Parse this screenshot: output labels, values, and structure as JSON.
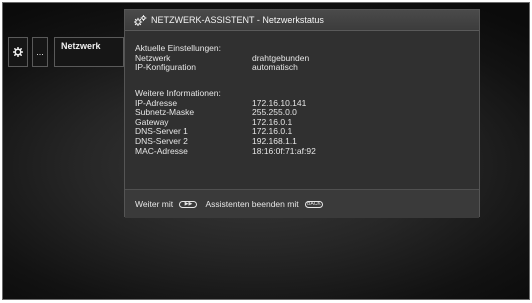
{
  "nav": {
    "more_label": "...",
    "network_label": "Netzwerk"
  },
  "dialog": {
    "title": "NETZWERK-ASSISTENT - Netzwerkstatus",
    "current_section": {
      "heading": "Aktuelle Einstellungen:",
      "rows": [
        {
          "label": "Netzwerk",
          "value": "drahtgebunden"
        },
        {
          "label": "IP-Konfiguration",
          "value": "automatisch"
        }
      ]
    },
    "more_section": {
      "heading": "Weitere Informationen:",
      "rows": [
        {
          "label": "IP-Adresse",
          "value": "172.16.10.141"
        },
        {
          "label": "Subnetz-Maske",
          "value": "255.255.0.0"
        },
        {
          "label": "Gateway",
          "value": "172.16.0.1"
        },
        {
          "label": "DNS-Server 1",
          "value": "172.16.0.1"
        },
        {
          "label": "DNS-Server 2",
          "value": "192.168.1.1"
        },
        {
          "label": "MAC-Adresse",
          "value": "18:16:0f:71:af:92"
        }
      ]
    },
    "footer": {
      "next_label": "Weiter mit",
      "next_icon": "forward-button-icon",
      "exit_label": "Assistenten beenden mit",
      "exit_icon": "back-button-icon"
    }
  }
}
